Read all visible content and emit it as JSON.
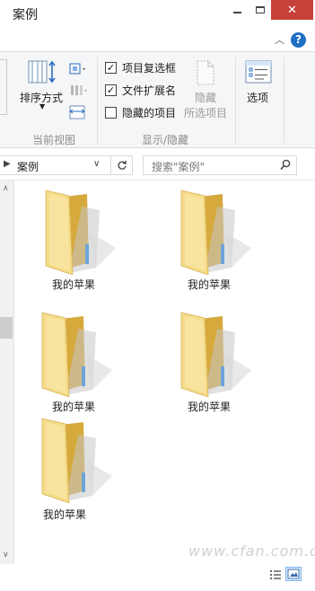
{
  "window": {
    "title": "案例",
    "close_glyph": "✕"
  },
  "help": {
    "glyph": "?"
  },
  "ribbon": {
    "sort_label": "排序方式",
    "current_view_group": "当前视图",
    "checkboxes": [
      {
        "label": "项目复选框",
        "checked": true
      },
      {
        "label": "文件扩展名",
        "checked": true
      },
      {
        "label": "隐藏的项目",
        "checked": false
      }
    ],
    "hide_label_1": "隐藏",
    "hide_label_2": "所选项目",
    "options_label": "选项",
    "show_hide_group": "显示/隐藏"
  },
  "address": {
    "path": "案例"
  },
  "search": {
    "placeholder": "搜索\"案例\""
  },
  "files": [
    {
      "name": "我的苹果"
    },
    {
      "name": "我的苹果"
    },
    {
      "name": "我的苹果"
    },
    {
      "name": "我的苹果"
    },
    {
      "name": "我的苹果"
    }
  ],
  "watermark": "www.cfan.com.cn",
  "colors": {
    "close": "#c7403a",
    "accent": "#1f6fc5",
    "folder": "#f1d27a"
  }
}
